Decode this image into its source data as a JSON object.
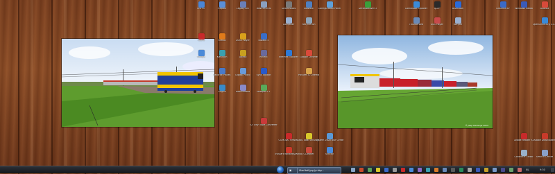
{
  "desktop": {
    "icons": [
      {
        "id": "i1",
        "label": "MSI RF",
        "color": "#4a86d6"
      },
      {
        "id": "i2",
        "label": "Prepare",
        "color": "#5a8fd8"
      },
      {
        "id": "i3",
        "label": "Legacy5VE",
        "color": "#6a7fb8"
      },
      {
        "id": "i4",
        "label": "WINSTATION",
        "color": "#8aa0c0"
      },
      {
        "id": "i5",
        "label": "Screenshots",
        "color": "#7a7a7a"
      },
      {
        "id": "i6",
        "label": "Network",
        "color": "#4f7fbf"
      },
      {
        "id": "i7",
        "label": "Configuration Panel",
        "color": "#5fa0d8"
      },
      {
        "id": "i8",
        "label": "Computer",
        "color": "#9ab0d0"
      },
      {
        "id": "i9",
        "label": "Recycle Bin",
        "color": "#8ea4b8"
      },
      {
        "id": "i10",
        "label": "Dreamweaver 3",
        "color": "#3a9f3a"
      },
      {
        "id": "i11",
        "label": "Firefox",
        "color": "#e07a1a"
      },
      {
        "id": "i12",
        "label": "Duns Player",
        "color": "#d9a11b"
      },
      {
        "id": "i13",
        "label": "Buzzkit 5",
        "color": "#3a6ec8"
      },
      {
        "id": "i14",
        "label": "Kiesdoch",
        "color": "#3aa0b0"
      },
      {
        "id": "i15",
        "label": "Daedo",
        "color": "#c8a020"
      },
      {
        "id": "i16",
        "label": "Recent",
        "color": "#6a6a9a"
      },
      {
        "id": "i17",
        "label": "Internet Explorer",
        "color": "#2e7ad6"
      },
      {
        "id": "i18",
        "label": "Google Chrome",
        "color": "#d94a3a"
      },
      {
        "id": "i19",
        "label": "Favorite Places",
        "color": "#4a7ac8"
      },
      {
        "id": "i20",
        "label": "Digital Photo",
        "color": "#6a9ad8"
      },
      {
        "id": "i21",
        "label": "Sync Toolbar",
        "color": "#2a5ac8"
      },
      {
        "id": "i22",
        "label": "Pictures & Cinema",
        "color": "#d9a44a"
      },
      {
        "id": "i23",
        "label": "Origins",
        "color": "#3a8ac8"
      },
      {
        "id": "i24",
        "label": "Downloaded",
        "color": "#8a8ac8"
      },
      {
        "id": "i25",
        "label": "Notepad++",
        "color": "#5aaa5a"
      },
      {
        "id": "i26",
        "label": "EZ Vinyl Tape Converter",
        "color": "#c83a3a"
      },
      {
        "id": "i27",
        "label": "COMODO Firewall",
        "color": "#c82a2a"
      },
      {
        "id": "i28",
        "label": "360 Total Security",
        "color": "#d8c82a"
      },
      {
        "id": "i29",
        "label": "System 2000 Blur Center",
        "color": "#5a9ad8"
      },
      {
        "id": "i30",
        "label": "TruStart Windows/Winlogin",
        "color": "#c83a2a"
      },
      {
        "id": "i31",
        "label": "CCleaner",
        "color": "#c84a3a"
      },
      {
        "id": "i32",
        "label": "Syncdy",
        "color": "#4a8ad8"
      },
      {
        "id": "i33",
        "label": "ControlBar Explorer",
        "color": "#3a8ad8"
      },
      {
        "id": "i34",
        "label": "QCFP",
        "color": "#2a2a2a"
      },
      {
        "id": "i35",
        "label": "Bluetooth",
        "color": "#2a6ad8"
      },
      {
        "id": "i36",
        "label": "Thunderbird",
        "color": "#6a8ab8"
      },
      {
        "id": "i37",
        "label": "AVS Player",
        "color": "#c84a4a"
      },
      {
        "id": "i38",
        "label": "Recycle",
        "color": "#9ab0d0"
      },
      {
        "id": "i39",
        "label": "Opera",
        "color": "#c82a2a"
      },
      {
        "id": "i40",
        "label": "Google",
        "color": "#4a8ad8"
      },
      {
        "id": "i41",
        "label": "CdBurnerXP",
        "color": "#3a6ac8"
      },
      {
        "id": "i42",
        "label": "Windows Media",
        "color": "#3a5ab8"
      },
      {
        "id": "i43",
        "label": "Android",
        "color": "#d84a3a"
      },
      {
        "id": "i44",
        "label": "OpenOffice.org 3.4.1",
        "color": "#3a8ad8"
      },
      {
        "id": "i45",
        "label": "Adobe Reader XI",
        "color": "#c82a2a"
      },
      {
        "id": "i46",
        "label": "Adobe Downloader",
        "color": "#c83a2a"
      },
      {
        "id": "i47",
        "label": "Controller Editor",
        "color": "#9ab0c8"
      },
      {
        "id": "i48",
        "label": "Service Centre",
        "color": "#8aa0c8"
      }
    ],
    "photo_left": {
      "caption": ""
    },
    "photo_right": {
      "caption": "© Jaap Hartsuijk 2015"
    }
  },
  "taskbar": {
    "buttons": [
      {
        "id": "t1",
        "label": "Vlad tail.jpg (p sby..."
      },
      {
        "id": "t2",
        "label": ""
      }
    ],
    "clock": "9:30",
    "language": "NL"
  }
}
